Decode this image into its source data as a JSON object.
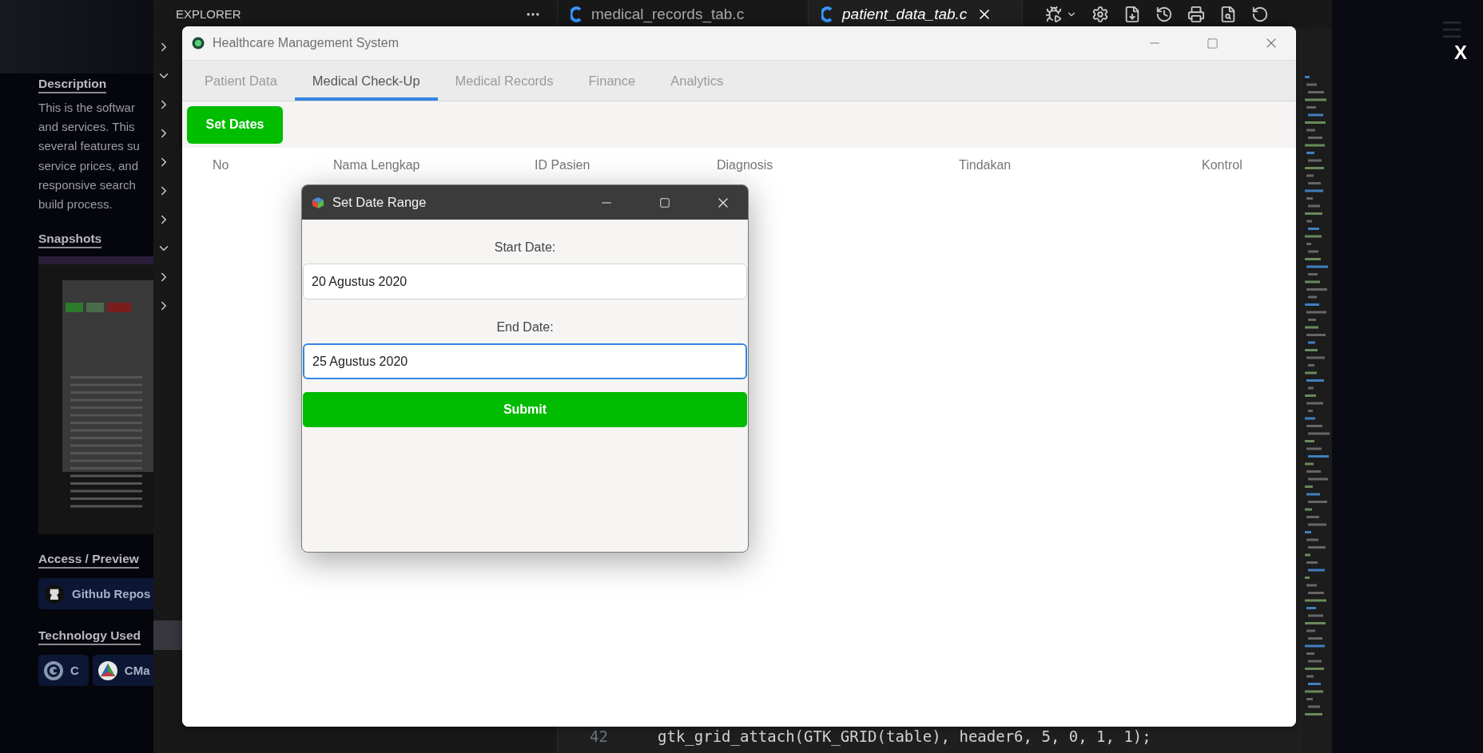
{
  "portfolio": {
    "description": {
      "heading": "Description",
      "lines": [
        "This is the softwar",
        "and services. This",
        "several features su",
        "service prices, and",
        "responsive search",
        "build process."
      ]
    },
    "snapshots": {
      "heading": "Snapshots"
    },
    "access": {
      "heading": "Access / Preview",
      "button": "Github Repos"
    },
    "technology": {
      "heading": "Technology Used",
      "badges": [
        {
          "kind": "c",
          "label": "C"
        },
        {
          "kind": "cmake",
          "label": "CMa"
        }
      ]
    }
  },
  "lightbox": {
    "close": "X"
  },
  "editor": {
    "explorer_title": "EXPLORER",
    "tabs": [
      {
        "label": "medical_records_tab.c",
        "selected": false
      },
      {
        "label": "patient_data_tab.c",
        "selected": true
      }
    ],
    "code_line": {
      "number": "42",
      "code": "gtk_grid_attach(GTK_GRID(table), header6, 5, 0, 1, 1);"
    }
  },
  "app": {
    "title": "Healthcare Management System",
    "tabs": [
      {
        "label": "Patient Data",
        "selected": false
      },
      {
        "label": "Medical Check-Up",
        "selected": true
      },
      {
        "label": "Medical Records",
        "selected": false
      },
      {
        "label": "Finance",
        "selected": false
      },
      {
        "label": "Analytics",
        "selected": false
      }
    ],
    "set_dates_button": "Set Dates",
    "columns": [
      "No",
      "Nama Lengkap",
      "ID Pasien",
      "Diagnosis",
      "Tindakan",
      "Kontrol"
    ]
  },
  "dialog": {
    "title": "Set Date Range",
    "fields": [
      {
        "label": "Start Date:",
        "value": "20 Agustus 2020",
        "focused": false
      },
      {
        "label": "End Date:",
        "value": "25 Agustus 2020",
        "focused": true
      }
    ],
    "submit": "Submit"
  }
}
